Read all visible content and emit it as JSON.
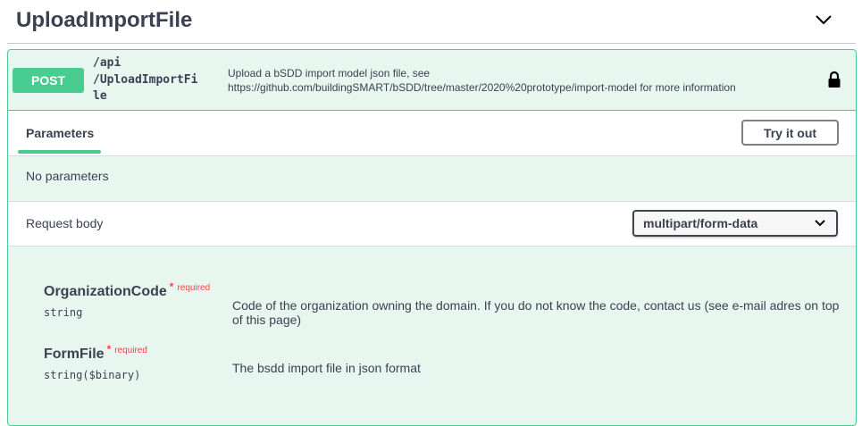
{
  "section": {
    "title": "UploadImportFile"
  },
  "operation": {
    "method": "POST",
    "path_lines": [
      "/api",
      "/UploadImportFi",
      "le"
    ],
    "description_lines": [
      "Upload a bSDD import model json file, see",
      "https://github.com/buildingSMART/bSDD/tree/master/2020%20prototype/import-model for more information"
    ],
    "lock_icon": "lock-icon"
  },
  "tabs": {
    "parameters_label": "Parameters",
    "try_label": "Try it out"
  },
  "no_parameters": "No parameters",
  "request_body": {
    "label": "Request body",
    "content_type": "multipart/form-data"
  },
  "fields": [
    {
      "name": "OrganizationCode",
      "star": "*",
      "required_label": "required",
      "type": "string",
      "description": "Code of the organization owning the domain. If you do not know the code, contact us (see e-mail adres on top of this page)"
    },
    {
      "name": "FormFile",
      "star": "*",
      "required_label": "required",
      "type": "string($binary)",
      "description": "The bsdd import file in json format"
    }
  ],
  "colors": {
    "post": "#49cc90",
    "post_bg": "#e8f6f0",
    "required": "#ff3f3f",
    "text": "#3b4151"
  }
}
